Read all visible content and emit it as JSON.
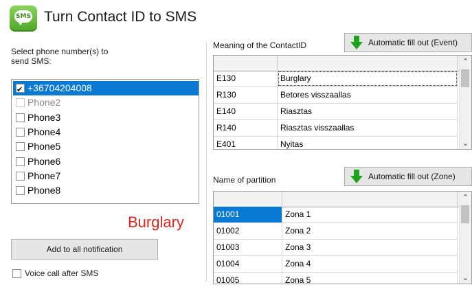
{
  "window": {
    "title": "Turn Contact ID to SMS",
    "icon": "sms-icon",
    "icon_text": "SMS"
  },
  "left": {
    "select_label_line1": "Select phone number(s) to",
    "select_label_line2": "send SMS:",
    "phones": [
      {
        "label": "+36704204008",
        "checked": true,
        "selected": true,
        "enabled": true
      },
      {
        "label": "Phone2",
        "checked": false,
        "selected": false,
        "enabled": false
      },
      {
        "label": "Phone3",
        "checked": false,
        "selected": false,
        "enabled": true
      },
      {
        "label": "Phone4",
        "checked": false,
        "selected": false,
        "enabled": true
      },
      {
        "label": "Phone5",
        "checked": false,
        "selected": false,
        "enabled": true
      },
      {
        "label": "Phone6",
        "checked": false,
        "selected": false,
        "enabled": true
      },
      {
        "label": "Phone7",
        "checked": false,
        "selected": false,
        "enabled": true
      },
      {
        "label": "Phone8",
        "checked": false,
        "selected": false,
        "enabled": true
      }
    ],
    "event_name": "Burglary",
    "event_color": "#e8211a",
    "add_button": "Add to all notification",
    "voice_call_label": "Voice call after SMS",
    "voice_call_checked": false
  },
  "contact_id": {
    "label": "Meaning of the ContactID",
    "auto_button": "Automatic fill out (Event)",
    "rows": [
      {
        "code": "E130",
        "meaning": "Burglary",
        "focused": true
      },
      {
        "code": "R130",
        "meaning": "Betores visszaallas"
      },
      {
        "code": "E140",
        "meaning": "Riasztas"
      },
      {
        "code": "R140",
        "meaning": "Riasztas visszaallas"
      },
      {
        "code": "E401",
        "meaning": "Nyitas"
      }
    ]
  },
  "partition": {
    "label": "Name of partition",
    "auto_button": "Automatic fill out (Zone)",
    "rows": [
      {
        "code": "01001",
        "name": "Zona 1",
        "selected": true
      },
      {
        "code": "01002",
        "name": "Zona 2"
      },
      {
        "code": "01003",
        "name": "Zona 3"
      },
      {
        "code": "01004",
        "name": "Zona 4"
      },
      {
        "code": "01005",
        "name": "Zona 5"
      }
    ]
  },
  "colors": {
    "selection": "#0a79d4",
    "arrow_green": "#1fa31a"
  }
}
